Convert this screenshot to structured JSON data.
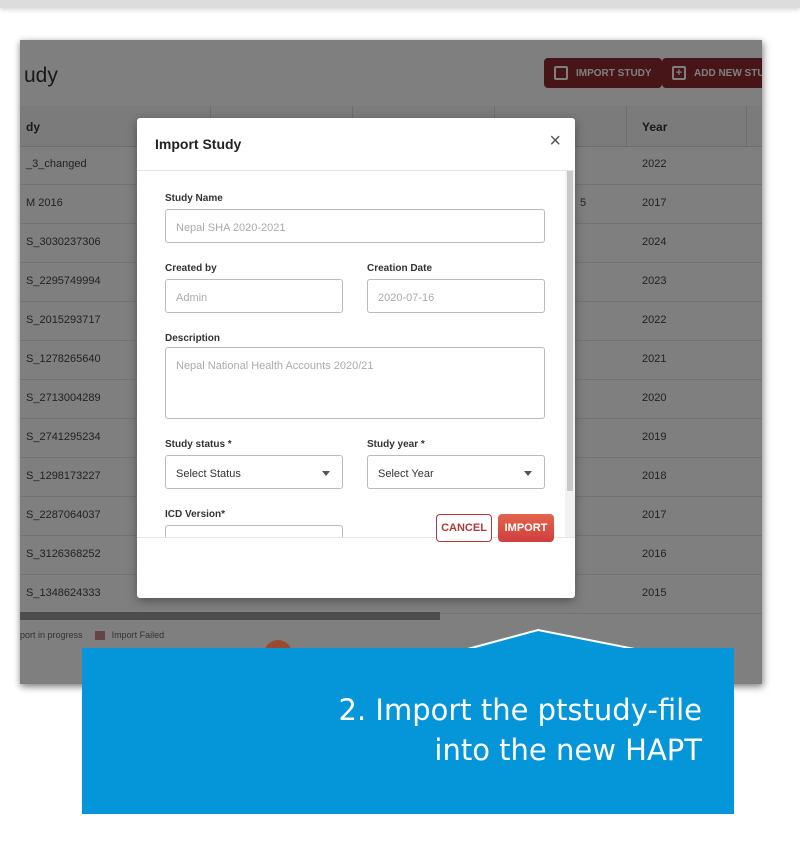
{
  "page": {
    "title_partial": "udy",
    "buttons": {
      "import_study": "IMPORT STUDY",
      "add_new_study": "ADD NEW STU"
    }
  },
  "table": {
    "headers": {
      "study": "dy",
      "year": "Year"
    },
    "rows": [
      {
        "study": "_3_changed",
        "year": "2022"
      },
      {
        "study": "M 2016",
        "mid": "5",
        "year": "2017"
      },
      {
        "study": "S_3030237306",
        "year": "2024"
      },
      {
        "study": "S_2295749994",
        "year": "2023"
      },
      {
        "study": "S_2015293717",
        "year": "2022"
      },
      {
        "study": "S_1278265640",
        "year": "2021"
      },
      {
        "study": "S_2713004289",
        "year": "2020"
      },
      {
        "study": "S_2741295234",
        "year": "2019"
      },
      {
        "study": "S_1298173227",
        "year": "2018"
      },
      {
        "study": "S_2287064037",
        "year": "2017"
      },
      {
        "study": "S_3126368252",
        "year": "2016"
      },
      {
        "study": "S_1348624333",
        "year": "2015"
      }
    ],
    "legend": {
      "in_progress": "port in progress",
      "failed": "Import Failed"
    }
  },
  "modal": {
    "title": "Import Study",
    "close": "×",
    "study_name": {
      "label": "Study Name",
      "value": "Nepal SHA 2020-2021"
    },
    "created_by": {
      "label": "Created by",
      "value": "Admin"
    },
    "creation_date": {
      "label": "Creation Date",
      "value": "2020-07-16"
    },
    "description": {
      "label": "Description",
      "value": "Nepal National Health Accounts 2020/21"
    },
    "study_status": {
      "label": "Study status *",
      "value": "Select Status"
    },
    "study_year": {
      "label": "Study year *",
      "value": "Select Year"
    },
    "icd_version": {
      "label": "ICD Version*"
    },
    "cancel": "CANCEL",
    "import": "IMPORT"
  },
  "callout": {
    "line1": "2. Import the ptstudy-file",
    "line2": "into the new HAPT"
  },
  "colors": {
    "callout": "#0496d9",
    "primary_button": "#8e2b2e",
    "import_button": "#d9534f"
  }
}
